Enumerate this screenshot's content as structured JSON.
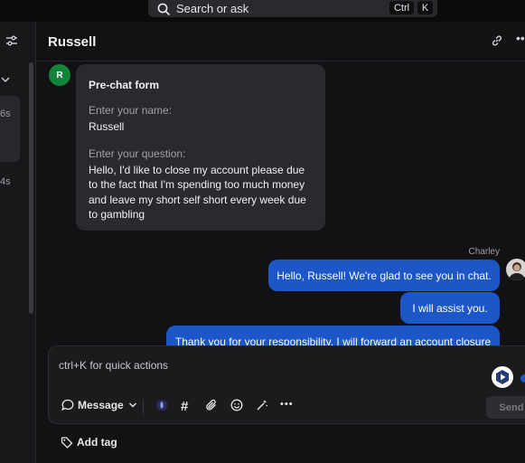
{
  "search": {
    "label": "Search or ask",
    "shortcut_mod": "Ctrl",
    "shortcut_key": "K"
  },
  "sidebar": {
    "times": [
      "6s",
      "4s"
    ]
  },
  "conversation": {
    "title": "Russell",
    "customer_initial": "R",
    "form": {
      "title": "Pre-chat form",
      "name_label": "Enter your name:",
      "name_value": "Russell",
      "question_label": "Enter your question:",
      "question_value": "Hello, I'd like to close my account please due to the fact that I'm spending too much money and leave my short self short every week due to gambling"
    },
    "agent_name": "Charley",
    "messages": [
      "Hello, Russell! We're glad to see you in chat.",
      "I will assist you.",
      "Thank you for your responsibility. I will forward an account closure"
    ]
  },
  "composer": {
    "placeholder": "ctrl+K for quick actions",
    "mode_label": "Message",
    "send_label": "Send"
  },
  "footer": {
    "add_tag_label": "Add tag"
  },
  "colors": {
    "accent": "#1c56c7",
    "avatar_green": "#15843b",
    "background": "#121214"
  }
}
